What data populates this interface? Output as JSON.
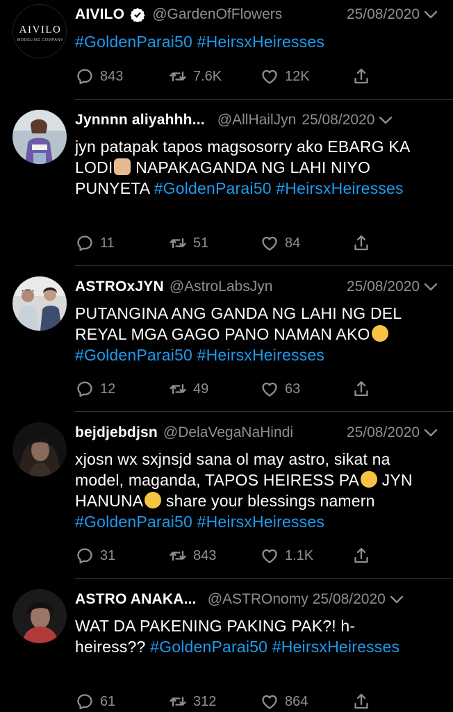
{
  "tweets": [
    {
      "name": "AIVILO",
      "handle": "@GardenOfFlowers",
      "date": "25/08/2020",
      "verified": true,
      "logo_text": "AIVILO",
      "logo_sub": "MODELING COMPANY",
      "text_parts": [
        {
          "t": "#GoldenParai50 #HeirsxHeiresses",
          "tag": true
        }
      ],
      "replies": "843",
      "retweets": "7.6K",
      "likes": "12K"
    },
    {
      "name": "Jynnnn aliyahhh...",
      "handle": "@AllHailJyn",
      "date": "25/08/2020",
      "text_parts": [
        {
          "t": "jyn patapak tapos magsosorry ako EBARG KA LODI",
          "tag": false
        },
        {
          "emoji": "raised-fist-emoji"
        },
        {
          "t": " NAPAKAGANDA NG LAHI NIYO PUNYETA ",
          "tag": false
        },
        {
          "t": "#GoldenParai50 #HeirsxHeiresses",
          "tag": true
        }
      ],
      "replies": "11",
      "retweets": "51",
      "likes": "84"
    },
    {
      "name": "ASTROxJYN",
      "handle": "@AstroLabsJyn",
      "date": "25/08/2020",
      "text_parts": [
        {
          "t": "PUTANGINA ANG GANDA NG LAHI NG DEL REYAL MGA GAGO PANO NAMAN AKO",
          "tag": false
        },
        {
          "emoji": "crying-face-emoji"
        },
        {
          "t": " #GoldenParai50 #HeirsxHeiresses",
          "tag": true
        }
      ],
      "replies": "12",
      "retweets": "49",
      "likes": "63"
    },
    {
      "name": "bejdjebdjsn",
      "handle": "@DelaVegaNaHindi",
      "date": "25/08/2020",
      "text_parts": [
        {
          "t": "xjosn wx sxjnsjd sana ol may astro, sikat na model, maganda, TAPOS HEIRESS PA",
          "tag": false
        },
        {
          "emoji": "crying-face-emoji"
        },
        {
          "t": " JYN HANUNA",
          "tag": false
        },
        {
          "emoji": "sneezing-face-emoji"
        },
        {
          "t": " share your blessings namern ",
          "tag": false
        },
        {
          "t": "#GoldenParai50 #HeirsxHeiresses",
          "tag": true
        }
      ],
      "replies": "31",
      "retweets": "843",
      "likes": "1.1K"
    },
    {
      "name": "ASTRO ANAKA...",
      "handle": "@ASTROnomy",
      "date": "25/08/2020",
      "text_parts": [
        {
          "t": "WAT DA PAKENING PAKING PAK?! h-heiress?? ",
          "tag": false
        },
        {
          "t": "#GoldenParai50 #HeirsxHeiresses",
          "tag": true
        }
      ],
      "replies": "61",
      "retweets": "312",
      "likes": "864"
    }
  ],
  "colors": {
    "background": "#000000",
    "text": "#ffffff",
    "muted": "#8b9095",
    "hashtag": "#1d9bf0",
    "divider": "#2f3336"
  }
}
